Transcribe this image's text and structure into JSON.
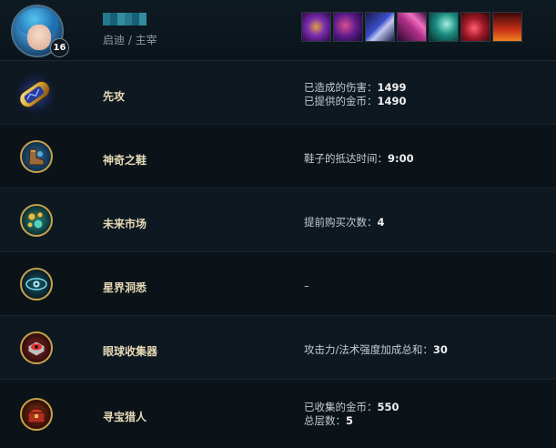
{
  "header": {
    "level": "16",
    "subtitle": "启迪 / 主宰",
    "items": [
      {
        "icon": "item-1-icon",
        "color": "#7a2bb0"
      },
      {
        "icon": "item-2-icon",
        "color": "#5a1a8a"
      },
      {
        "icon": "item-3-icon",
        "color": "#3a4ec8"
      },
      {
        "icon": "item-4-icon",
        "color": "#b0308a"
      },
      {
        "icon": "item-5-icon",
        "color": "#1a8a80"
      },
      {
        "icon": "item-6-icon",
        "color": "#a01828"
      },
      {
        "icon": "item-7-icon",
        "color": "#c83018"
      }
    ]
  },
  "runes": [
    {
      "name": "先攻",
      "lines": [
        {
          "label": "已造成的伤害：",
          "value": "1499"
        },
        {
          "label": "已提供的金币：",
          "value": "1490"
        }
      ]
    },
    {
      "name": "神奇之鞋",
      "lines": [
        {
          "label": "鞋子的抵达时间：",
          "value": "9:00"
        }
      ]
    },
    {
      "name": "未来市场",
      "lines": [
        {
          "label": "提前购买次数：",
          "value": "4"
        }
      ]
    },
    {
      "name": "星界洞悉",
      "lines": [
        {
          "label": "–",
          "value": ""
        }
      ]
    },
    {
      "name": "眼球收集器",
      "lines": [
        {
          "label": "攻击力/法术强度加成总和：",
          "value": "30"
        }
      ]
    },
    {
      "name": "寻宝猎人",
      "lines": [
        {
          "label": "已收集的金币：",
          "value": "550"
        },
        {
          "label": "总层数：",
          "value": "5"
        }
      ]
    }
  ]
}
